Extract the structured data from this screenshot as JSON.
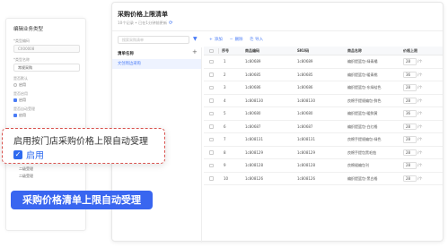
{
  "left_panel": {
    "title": "编辑业务类型",
    "code_label": "*类型编码",
    "code_value": "CX00008",
    "name_label": "*类型名称",
    "name_value": "常规采购",
    "default_label": "是否默认",
    "default_option": "启用",
    "enabled_label": "是否启用",
    "enabled_option": "启用",
    "auto_label": "是否自动受理",
    "auto_option": "启用",
    "level1": "二级受理",
    "level2": "二级受理"
  },
  "callout": {
    "title": "启用按门店采购价格上限自动受理",
    "option_label": "启用",
    "check_icon": "✓"
  },
  "banner": {
    "text": "采购价格清单上限自动受理"
  },
  "right_panel": {
    "title": "采购价格上限清单",
    "subtitle": "10个记录 • 已在1分钟前更新",
    "search_placeholder": "搜索采购清单",
    "list_header": "清单名称",
    "list_add": "+",
    "list_items": [
      "文创周边采购"
    ],
    "toolbar": {
      "add": "添加",
      "delete": "删除",
      "import": "导入"
    },
    "columns": [
      "序号",
      "商品编码",
      "SKU码",
      "商品名称",
      "价格上限"
    ],
    "rows": [
      {
        "no": "1",
        "code": "1c80689",
        "sku": "1c80689",
        "name": "编织提篮包-绿青橘",
        "price": "28",
        "unit": "/个"
      },
      {
        "no": "2",
        "code": "1c80685",
        "sku": "1c80685",
        "name": "编织提篮包-暖青桃",
        "price": "36",
        "unit": "/个"
      },
      {
        "no": "3",
        "code": "1c80686",
        "sku": "1c80686",
        "name": "编织提篮包-东绿桔色",
        "price": "28",
        "unit": "/个"
      },
      {
        "no": "4",
        "code": "1c808130",
        "sku": "1c808130",
        "name": "良棉手提规编包-鲜色",
        "price": "28",
        "unit": "/个"
      },
      {
        "no": "5",
        "code": "1c80680",
        "sku": "1c80680",
        "name": "编织提篮包-暖鲜黄",
        "price": "36",
        "unit": "/个"
      },
      {
        "no": "6",
        "code": "1c80687",
        "sku": "1c80687",
        "name": "编织提篮包-白红格",
        "price": "28",
        "unit": "/个"
      },
      {
        "no": "7",
        "code": "1c808131",
        "sku": "1c808131",
        "name": "良棉手提规编包-绿色",
        "price": "28",
        "unit": "/个"
      },
      {
        "no": "8",
        "code": "1c808129",
        "sku": "1c808129",
        "name": "良棉手提包黑毛烛",
        "price": "28",
        "unit": "/个"
      },
      {
        "no": "9",
        "code": "1c808128",
        "sku": "1c808128",
        "name": "良棉缀编包刊",
        "price": "28",
        "unit": "/个"
      },
      {
        "no": "10",
        "code": "1c808126",
        "sku": "1c808126",
        "name": "编织提篮包-黑白格",
        "price": "28",
        "unit": "/个"
      }
    ]
  },
  "colors": {
    "accent": "#3966f0",
    "callout_border": "#d9534f"
  }
}
